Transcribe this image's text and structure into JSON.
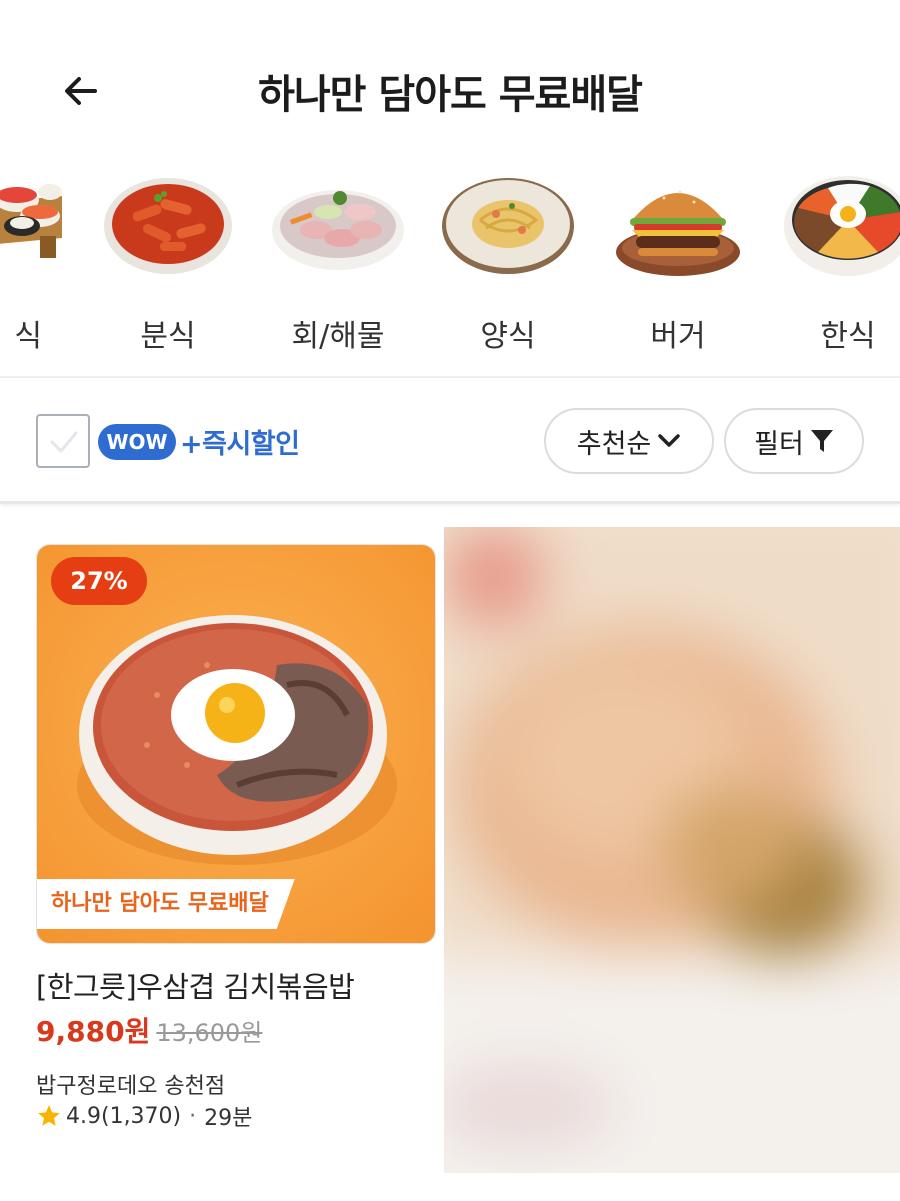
{
  "header": {
    "title": "하나만 담아도 무료배달",
    "back_icon": "arrow-left-icon"
  },
  "categories": [
    {
      "label": "식",
      "icon": "sushi-icon"
    },
    {
      "label": "분식",
      "icon": "tteokbokki-icon"
    },
    {
      "label": "회/해물",
      "icon": "sashimi-icon"
    },
    {
      "label": "양식",
      "icon": "pasta-icon"
    },
    {
      "label": "버거",
      "icon": "burger-icon"
    },
    {
      "label": "한식",
      "icon": "bibimbap-icon"
    }
  ],
  "filter_bar": {
    "checkbox_checked": false,
    "wow_badge": "WOW",
    "instant_label": "+즉시할인",
    "sort_label": "추천순",
    "filter_label": "필터"
  },
  "product": {
    "discount": "27%",
    "promo_tag": "하나만 담아도 무료배달",
    "name": "[한그릇]우삼겹 김치볶음밥",
    "price": "9,880원",
    "original_price": "13,600원",
    "store": "밥구정로데오 송천점",
    "rating": "4.9(1,370)",
    "separator": "·",
    "delivery_time": "29분"
  },
  "colors": {
    "accent_blue": "#2f6cd1",
    "discount_red": "#e53e12",
    "price_red": "#d8381c",
    "promo_orange": "#e8641c",
    "card_bg_orange": "#f7a241"
  }
}
